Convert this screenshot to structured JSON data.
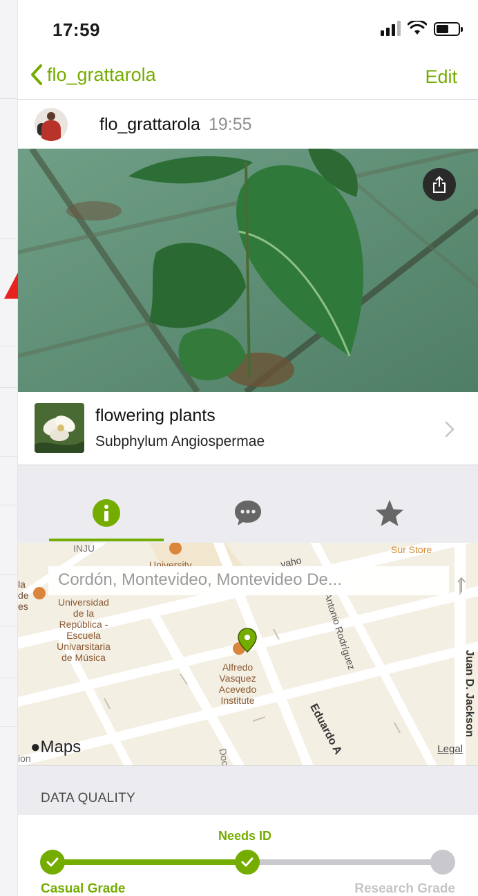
{
  "status_bar": {
    "time": "17:59"
  },
  "nav": {
    "back_label": "flo_grattarola",
    "edit_label": "Edit"
  },
  "observation": {
    "username": "flo_grattarola",
    "time": "19:55"
  },
  "taxon": {
    "common_name": "flowering plants",
    "scientific_name": "Subphylum Angiospermae"
  },
  "tabs": [
    {
      "id": "info",
      "icon": "info-icon",
      "active": true
    },
    {
      "id": "activity",
      "icon": "chat-bubble-icon",
      "active": false
    },
    {
      "id": "favorites",
      "icon": "star-icon",
      "active": false
    }
  ],
  "map": {
    "place_guess": "Cordón, Montevideo, Montevideo De...",
    "maps_label": "Maps",
    "legal_label": "Legal",
    "labels": {
      "inju": "INJU",
      "university_top": "University",
      "sur_store": "Sur Store",
      "universidad": "Universidad\nde la\nRepública -\nEscuela\nUnivarsitaria\nde Música",
      "alfredo": "Alfredo\nVasquez\nAcevedo\nInstitute",
      "antonio": "Antonio Rodríguez",
      "eduardo": "Eduardo A",
      "juan": "Juan D. Jackson",
      "doc": "Doc",
      "rabo": "vaho",
      "ion": "ion",
      "la": "la\nde\nes"
    },
    "colors": {
      "road": "#ffffff",
      "land": "#f4efe3",
      "pin": "#74ac00"
    }
  },
  "data_quality": {
    "header": "DATA QUALITY",
    "middle_label": "Needs ID",
    "left_label": "Casual Grade",
    "right_label": "Research Grade",
    "level": 2,
    "levels_total": 3
  },
  "colors": {
    "accent": "#74ac00",
    "inactive": "#c9c9cd",
    "tab_bg": "#ececf0"
  }
}
